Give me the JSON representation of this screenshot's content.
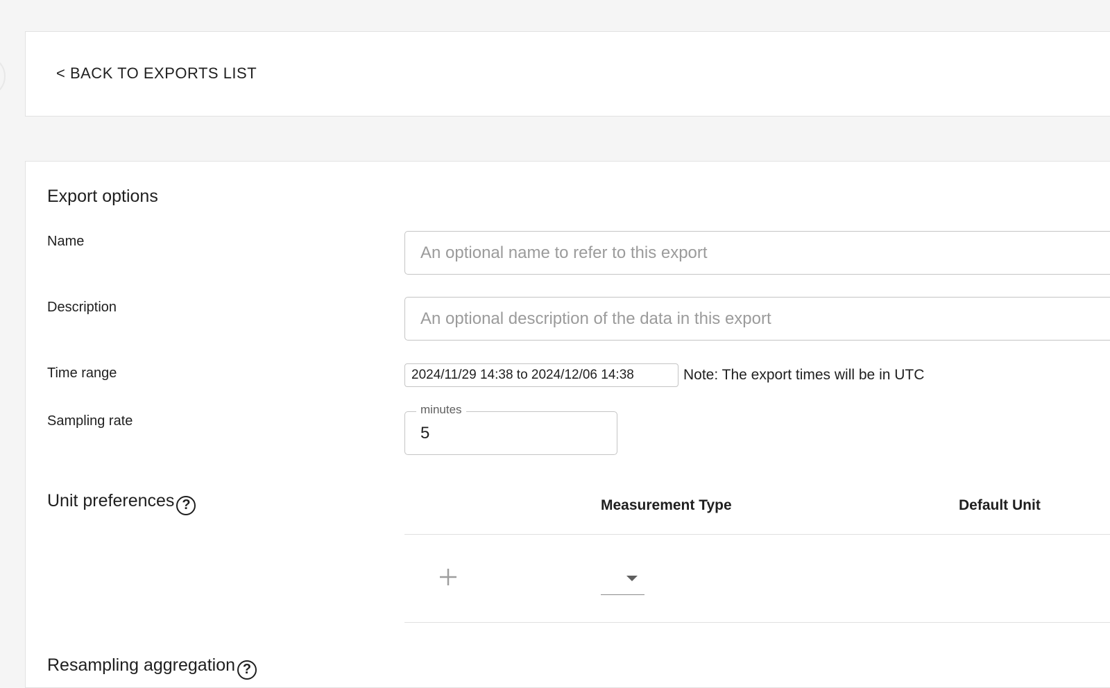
{
  "navigation": {
    "back_label": "< BACK TO EXPORTS LIST"
  },
  "export_options": {
    "title": "Export options",
    "name": {
      "label": "Name",
      "value": "",
      "placeholder": "An optional name to refer to this export"
    },
    "description": {
      "label": "Description",
      "value": "",
      "placeholder": "An optional description of the data in this export"
    },
    "time_range": {
      "label": "Time range",
      "value": "2024/11/29 14:38 to 2024/12/06 14:38",
      "note": "Note: The export times will be in UTC"
    },
    "sampling_rate": {
      "label": "Sampling rate",
      "unit_label": "minutes",
      "value": "5"
    }
  },
  "unit_preferences": {
    "title": "Unit preferences",
    "help_icon": "question-circle-icon",
    "columns": [
      "Measurement Type",
      "Default Unit"
    ],
    "add_icon": "plus-icon",
    "measurement_type_selected": ""
  },
  "next_section": {
    "title": "Resampling aggregation",
    "help_icon": "question-circle-icon"
  },
  "colors": {
    "page_background": "#f5f5f5",
    "card_background": "#ffffff",
    "border": "#e2e2e2",
    "input_border": "#c4c4c4",
    "placeholder": "#9b9b9b",
    "text": "#1f1f1f"
  }
}
